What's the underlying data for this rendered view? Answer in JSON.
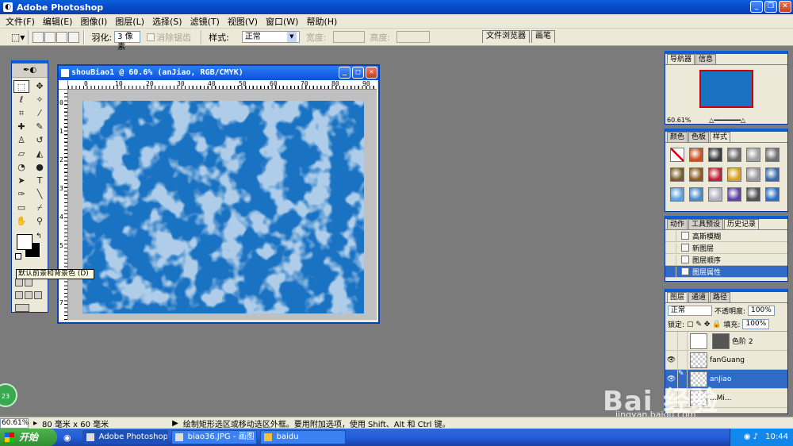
{
  "app": {
    "title": "Adobe Photoshop"
  },
  "menu": [
    "文件(F)",
    "编辑(E)",
    "图像(I)",
    "图层(L)",
    "选择(S)",
    "滤镜(T)",
    "视图(V)",
    "窗口(W)",
    "帮助(H)"
  ],
  "options": {
    "feather_label": "羽化:",
    "feather_value": "3 像素",
    "antialias_label": "消除锯齿",
    "style_label": "样式:",
    "style_value": "正常",
    "width_label": "宽度:",
    "height_label": "高度:",
    "well_tabs": [
      "文件浏览器",
      "画笔"
    ]
  },
  "tooltip": "默认前景和背景色 (D)",
  "document": {
    "title": "shouBiao1 @ 60.6% (anJiao, RGB/CMYK)",
    "ruler_h": [
      "0",
      "10",
      "20",
      "30",
      "40",
      "50",
      "60",
      "70",
      "80",
      "90"
    ],
    "ruler_v": [
      "0",
      "1",
      "2",
      "3",
      "4",
      "5",
      "6",
      "7"
    ]
  },
  "navigator": {
    "tabs": [
      "导航器",
      "信息"
    ],
    "zoom": "60.61%"
  },
  "styles": {
    "tabs": [
      "颜色",
      "色板",
      "样式"
    ],
    "swatches": [
      "#ffffff",
      "#c8501e",
      "#3a3a3a",
      "#6a6a6a",
      "#a0a0a0",
      "#707070",
      "#7a5a2a",
      "#8a5a20",
      "#c02030",
      "#d8a020",
      "#9a9a9a",
      "#3a6aa8",
      "#5aa0d8",
      "#4a8ac8",
      "#b0b0c0",
      "#6040a0",
      "#505050",
      "#2a70c0"
    ]
  },
  "history": {
    "tabs": [
      "动作",
      "工具预设",
      "历史记录"
    ],
    "items": [
      "高斯模糊",
      "新图层",
      "图层顺序",
      "图层属性"
    ]
  },
  "layers": {
    "tabs": [
      "图层",
      "通道",
      "路径"
    ],
    "mode": "正常",
    "opacity_label": "不透明度:",
    "opacity": "100%",
    "lock_label": "锁定:",
    "fill_label": "填充:",
    "fill": "100%",
    "items": [
      {
        "name": "色阶 2"
      },
      {
        "name": "fanGuang"
      },
      {
        "name": "anJiao"
      },
      {
        "name": "...Mi..."
      }
    ]
  },
  "status": {
    "zoom": "60.61%",
    "doc_size": "80 毫米 x 60 毫米",
    "hint": "绘制矩形选区或移动选区外框。要用附加选项，使用 Shift、Alt 和 Ctrl 键。"
  },
  "taskbar": {
    "start": "开始",
    "tasks": [
      "Adobe Photoshop",
      "biao36.JPG - 画图",
      "baidu"
    ],
    "clock": "10:44",
    "badge": "23"
  },
  "watermark": {
    "text": "Bai 经验",
    "url": "jingyan.baidu.com"
  }
}
